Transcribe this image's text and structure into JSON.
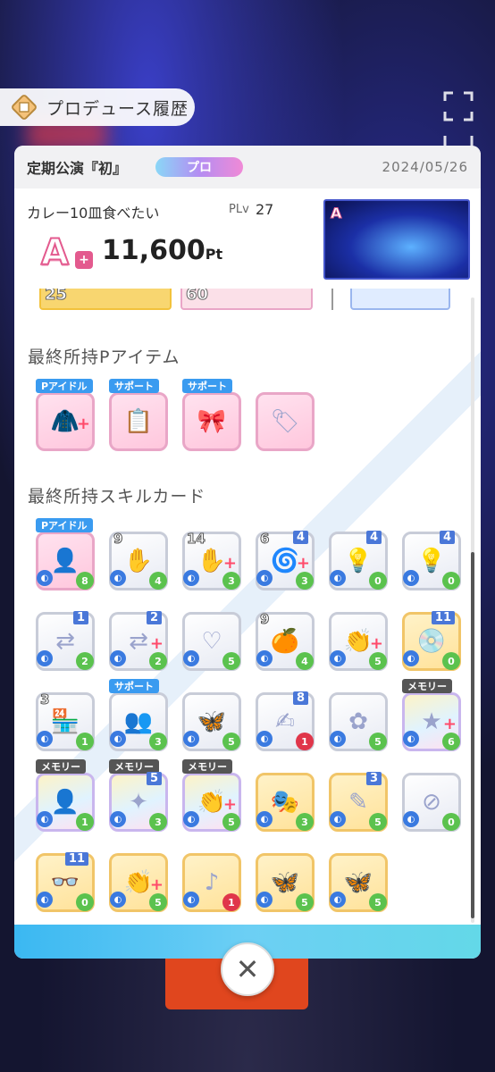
{
  "header": {
    "title": "プロデュース履歴"
  },
  "summary": {
    "live_name": "定期公演『初』",
    "rank": "プロ",
    "date": "2024/05/26",
    "produce_name": "カレー10皿食べたい",
    "plv_label": "PLv",
    "plv_value": "27",
    "grade": "A",
    "grade_plus": "+",
    "score": "11,600",
    "score_unit": "Pt"
  },
  "strip": {
    "left_num": "25",
    "mid_num": "60"
  },
  "items_section": {
    "title": "最終所持Pアイテム"
  },
  "items": [
    {
      "tag": "Pアイドル",
      "tag_color": "blue",
      "icon": "jacket-icon",
      "plus": true
    },
    {
      "tag": "サポート",
      "tag_color": "blue",
      "icon": "clipboard-icon",
      "plus": false
    },
    {
      "tag": "サポート",
      "tag_color": "blue",
      "icon": "ribbon-bell-icon",
      "plus": false
    },
    {
      "tag": "",
      "tag_color": "",
      "icon": "tag-charm-icon",
      "plus": false
    }
  ],
  "cards_section": {
    "title": "最終所持スキルカード"
  },
  "cards": [
    {
      "tag": "Pアイドル",
      "tag_color": "blue",
      "num": "",
      "cost": "8",
      "cost_color": "green",
      "frame": "pink",
      "icon": "idol-portrait-icon"
    },
    {
      "tag": "",
      "num": "9",
      "cost": "4",
      "cost_color": "green",
      "frame": "white",
      "icon": "hand-icon"
    },
    {
      "tag": "",
      "num": "14",
      "cost": "3",
      "cost_color": "green",
      "frame": "white",
      "icon": "hand-icon",
      "plus": true
    },
    {
      "tag": "",
      "num": "6",
      "num_right": "4",
      "cost": "3",
      "cost_color": "green",
      "frame": "white",
      "icon": "spiral-icon",
      "plus": true
    },
    {
      "tag": "",
      "num_right": "4",
      "cost": "0",
      "cost_color": "green",
      "frame": "white",
      "icon": "bulb-icon"
    },
    {
      "tag": "",
      "num_right": "4",
      "cost": "0",
      "cost_color": "green",
      "frame": "white",
      "icon": "bulb-icon"
    },
    {
      "tag": "",
      "num_right": "1",
      "cost": "2",
      "cost_color": "green",
      "frame": "white",
      "icon": "arrows-icon"
    },
    {
      "tag": "",
      "num_right": "2",
      "cost": "2",
      "cost_color": "green",
      "frame": "white",
      "icon": "arrows-icon",
      "plus": true
    },
    {
      "tag": "",
      "num": "",
      "cost": "5",
      "cost_color": "green",
      "frame": "white",
      "icon": "heart-hand-icon"
    },
    {
      "tag": "",
      "num": "9",
      "cost": "4",
      "cost_color": "green",
      "frame": "white",
      "icon": "orange-icon"
    },
    {
      "tag": "",
      "num": "",
      "cost": "5",
      "cost_color": "green",
      "frame": "white",
      "icon": "clap-icon",
      "plus": true
    },
    {
      "tag": "",
      "num_right": "11",
      "cost": "0",
      "cost_color": "green",
      "frame": "gold",
      "icon": "record-icon"
    },
    {
      "tag": "",
      "num": "3",
      "cost": "1",
      "cost_color": "green",
      "frame": "white",
      "icon": "shop-icon"
    },
    {
      "tag": "サポート",
      "tag_color": "blue",
      "num": "",
      "cost": "3",
      "cost_color": "green",
      "frame": "white",
      "icon": "group-photo-icon"
    },
    {
      "tag": "",
      "num": "",
      "cost": "5",
      "cost_color": "green",
      "frame": "white",
      "icon": "butterfly-icon"
    },
    {
      "tag": "",
      "num_right": "8",
      "cost": "1",
      "cost_color": "red",
      "frame": "white",
      "icon": "sign-icon"
    },
    {
      "tag": "",
      "num": "",
      "cost": "5",
      "cost_color": "green",
      "frame": "white",
      "icon": "flower-icon"
    },
    {
      "tag": "メモリー",
      "tag_color": "gray",
      "num": "",
      "cost": "6",
      "cost_color": "green",
      "frame": "rainbow",
      "icon": "star-icon",
      "plus": true
    },
    {
      "tag": "メモリー",
      "tag_color": "gray",
      "num": "",
      "cost": "1",
      "cost_color": "green",
      "frame": "rainbow",
      "icon": "portrait-icon"
    },
    {
      "tag": "メモリー",
      "tag_color": "gray",
      "num_right": "5",
      "cost": "3",
      "cost_color": "green",
      "frame": "rainbow",
      "icon": "wand-icon"
    },
    {
      "tag": "メモリー",
      "tag_color": "gray",
      "num": "",
      "cost": "5",
      "cost_color": "green",
      "frame": "rainbow",
      "icon": "clap-icon",
      "plus": true
    },
    {
      "tag": "",
      "num": "",
      "cost": "3",
      "cost_color": "green",
      "frame": "gold",
      "icon": "stage-icon"
    },
    {
      "tag": "",
      "num_right": "3",
      "cost": "5",
      "cost_color": "green",
      "frame": "gold",
      "icon": "pen-icon"
    },
    {
      "tag": "",
      "num": "",
      "cost": "0",
      "cost_color": "green",
      "frame": "white",
      "icon": "trouble-icon"
    },
    {
      "tag": "",
      "num_right": "11",
      "cost": "0",
      "cost_color": "green",
      "frame": "gold",
      "icon": "glasses-icon"
    },
    {
      "tag": "",
      "num": "",
      "cost": "5",
      "cost_color": "green",
      "frame": "gold",
      "icon": "clap-icon",
      "plus": true
    },
    {
      "tag": "",
      "num": "",
      "cost": "1",
      "cost_color": "red",
      "frame": "gold",
      "icon": "note-icon"
    },
    {
      "tag": "",
      "num": "",
      "cost": "5",
      "cost_color": "green",
      "frame": "gold",
      "icon": "butterfly-icon"
    },
    {
      "tag": "",
      "num": "",
      "cost": "5",
      "cost_color": "green",
      "frame": "gold",
      "icon": "butterfly-icon"
    }
  ],
  "footer": {
    "close_icon": "close-icon"
  }
}
